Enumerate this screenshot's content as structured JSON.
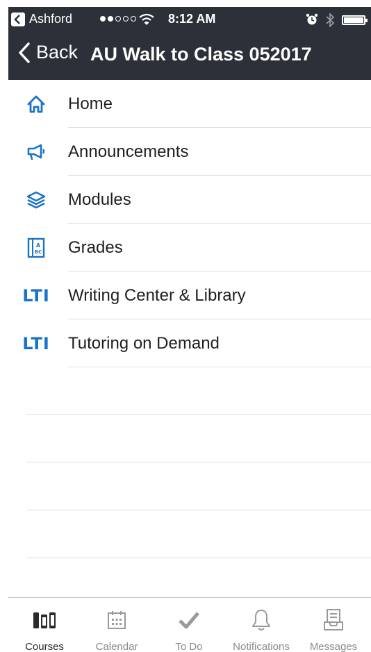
{
  "status_bar": {
    "carrier": "Ashford",
    "time": "8:12 AM",
    "signal_filled": 2,
    "signal_total": 5
  },
  "nav": {
    "back_label": "Back",
    "title": "AU Walk to Class 052017"
  },
  "menu": {
    "items": [
      {
        "label": "Home",
        "icon": "home-icon"
      },
      {
        "label": "Announcements",
        "icon": "megaphone-icon"
      },
      {
        "label": "Modules",
        "icon": "layers-icon"
      },
      {
        "label": "Grades",
        "icon": "grades-icon"
      },
      {
        "label": "Writing Center & Library",
        "icon": "lti-icon",
        "icon_text": "LTI"
      },
      {
        "label": "Tutoring on Demand",
        "icon": "lti-icon",
        "icon_text": "LTI"
      }
    ]
  },
  "tabs": [
    {
      "label": "Courses",
      "icon": "courses-icon",
      "active": true
    },
    {
      "label": "Calendar",
      "icon": "calendar-icon",
      "active": false
    },
    {
      "label": "To Do",
      "icon": "checkmark-icon",
      "active": false
    },
    {
      "label": "Notifications",
      "icon": "bell-icon",
      "active": false
    },
    {
      "label": "Messages",
      "icon": "inbox-icon",
      "active": false
    }
  ],
  "colors": {
    "navbar_bg": "#2c3038",
    "accent_blue": "#1a73c6",
    "tab_inactive": "#8a8a8a",
    "tab_active": "#2a2a2a"
  }
}
